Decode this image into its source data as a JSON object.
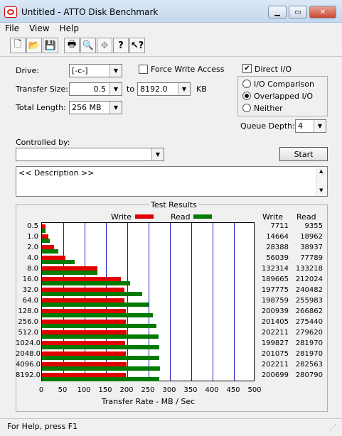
{
  "window": {
    "title": "Untitled - ATTO Disk Benchmark",
    "min_label": "▁",
    "max_label": "▭",
    "close_label": "✕"
  },
  "menu": {
    "items": [
      "File",
      "View",
      "Help"
    ]
  },
  "toolbar": {
    "icons": [
      "new-icon",
      "open-icon",
      "save-icon",
      "print-icon",
      "print-preview-icon",
      "move-icon",
      "help-icon",
      "context-help-icon"
    ]
  },
  "form": {
    "drive_label": "Drive:",
    "drive_value": "[-c-]",
    "force_write_label": "Force Write Access",
    "force_write_checked": false,
    "direct_io_label": "Direct I/O",
    "direct_io_checked": true,
    "transfer_size_label": "Transfer Size:",
    "transfer_from": "0.5",
    "to_label": "to",
    "transfer_to": "8192.0",
    "kb_label": "KB",
    "total_length_label": "Total Length:",
    "total_length_value": "256 MB",
    "io_options": [
      {
        "label": "I/O Comparison",
        "selected": false
      },
      {
        "label": "Overlapped I/O",
        "selected": true
      },
      {
        "label": "Neither",
        "selected": false
      }
    ],
    "queue_depth_label": "Queue Depth:",
    "queue_depth_value": "4",
    "controlled_by_label": "Controlled by:",
    "controlled_by_value": "",
    "start_label": "Start",
    "description": "<< Description >>"
  },
  "results": {
    "group_title": "Test Results",
    "legend_write": "Write",
    "legend_read": "Read",
    "col_write": "Write",
    "col_read": "Read",
    "x_axis_label": "Transfer Rate - MB / Sec"
  },
  "chart_data": {
    "type": "bar",
    "orientation": "horizontal",
    "categories": [
      "0.5",
      "1.0",
      "2.0",
      "4.0",
      "8.0",
      "16.0",
      "32.0",
      "64.0",
      "128.0",
      "256.0",
      "512.0",
      "1024.0",
      "2048.0",
      "4096.0",
      "8192.0"
    ],
    "series": [
      {
        "name": "Write",
        "color": "#e00000",
        "values": [
          7.5,
          14.3,
          27.7,
          54.7,
          129.2,
          185.2,
          193.1,
          194.1,
          196.2,
          196.7,
          197.5,
          195.1,
          196.4,
          197.5,
          196.0
        ]
      },
      {
        "name": "Read",
        "color": "#007a00",
        "values": [
          9.1,
          18.5,
          38.0,
          76.0,
          130.1,
          207.2,
          235.0,
          250.0,
          260.6,
          269.0,
          273.1,
          275.4,
          275.4,
          275.9,
          274.2
        ]
      }
    ],
    "write_numbers": [
      "7711",
      "14664",
      "28388",
      "56039",
      "132314",
      "189665",
      "197775",
      "198759",
      "200939",
      "201405",
      "202211",
      "199827",
      "201075",
      "202211",
      "200699"
    ],
    "read_numbers": [
      "9355",
      "18962",
      "38937",
      "77789",
      "133218",
      "212024",
      "240482",
      "255983",
      "266862",
      "275440",
      "279620",
      "281970",
      "281970",
      "282563",
      "280790"
    ],
    "xticks": [
      "0",
      "50",
      "100",
      "150",
      "200",
      "250",
      "300",
      "350",
      "400",
      "450",
      "500"
    ],
    "xlim": [
      0,
      500
    ],
    "xlabel": "Transfer Rate - MB / Sec",
    "grid": true
  },
  "status": {
    "text": "For Help, press F1"
  }
}
